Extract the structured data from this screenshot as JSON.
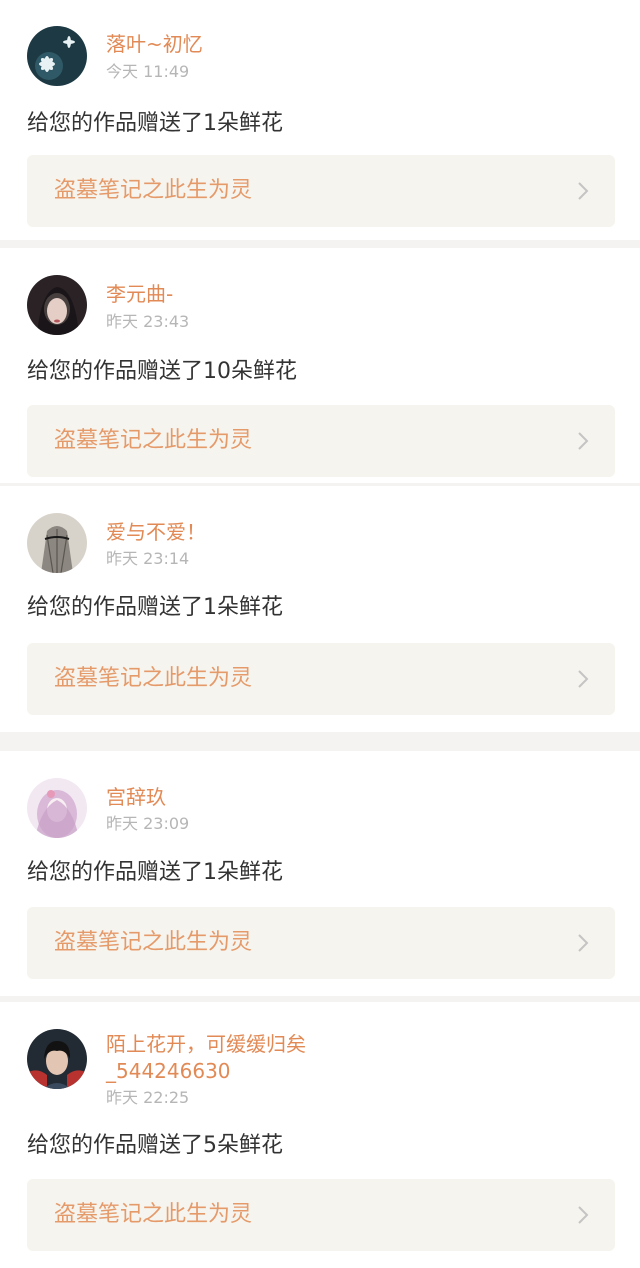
{
  "notifications": [
    {
      "user": "落叶~初忆",
      "time": "今天 11:49",
      "message": "给您的作品赠送了1朵鲜花",
      "work": "盗墓笔记之此生为灵"
    },
    {
      "user": "李元曲-",
      "time": "昨天 23:43",
      "message": "给您的作品赠送了10朵鲜花",
      "work": "盗墓笔记之此生为灵"
    },
    {
      "user": "爱与不爱！",
      "time": "昨天 23:14",
      "message": "给您的作品赠送了1朵鲜花",
      "work": "盗墓笔记之此生为灵"
    },
    {
      "user": "宫辞玖",
      "time": "昨天 23:09",
      "message": "给您的作品赠送了1朵鲜花",
      "work": "盗墓笔记之此生为灵"
    },
    {
      "user": "陌上花开，可缓缓归矣",
      "user_line2": "_544246630",
      "time": "昨天 22:25",
      "message": "给您的作品赠送了5朵鲜花",
      "work": "盗墓笔记之此生为灵"
    }
  ],
  "icons": {
    "chevron": "chevron-right-icon",
    "avatar": "user-avatar"
  },
  "colors": {
    "username": "#e28a55",
    "work_title": "#e59a6a",
    "work_bg": "#f6f4ee",
    "time": "#b6b6b6",
    "message": "#333333"
  }
}
